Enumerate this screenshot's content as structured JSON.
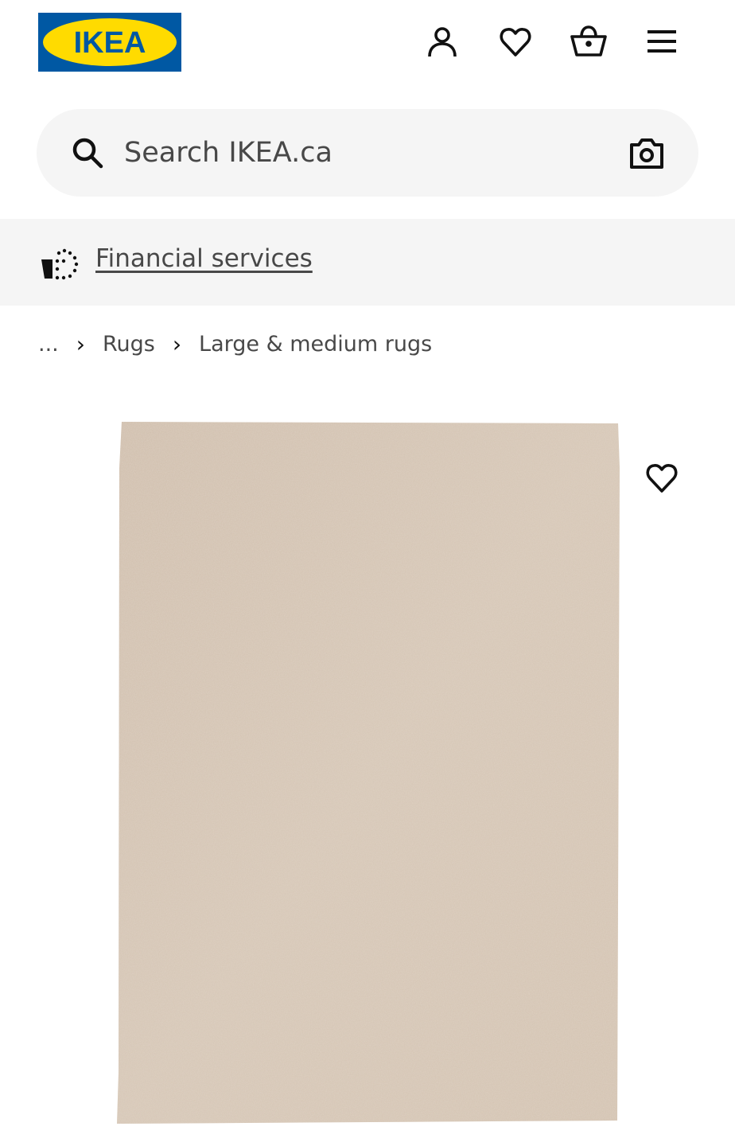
{
  "brand": {
    "logo_text": "IKEA",
    "colors": {
      "blue": "#0058a3",
      "yellow": "#ffdb00"
    }
  },
  "header": {
    "icons": [
      "profile-icon",
      "heart-icon",
      "shopping-bag-icon",
      "menu-icon"
    ]
  },
  "search": {
    "placeholder": "Search IKEA.ca",
    "value": "",
    "icons": [
      "search-icon",
      "camera-icon"
    ]
  },
  "banner": {
    "link_label": "Financial services",
    "icon": "financing-icon"
  },
  "breadcrumb": {
    "items": [
      "...",
      "Rugs",
      "Large & medium rugs"
    ]
  },
  "product": {
    "image_color": "#d2c1b0",
    "favourite_icon": "heart-icon"
  }
}
